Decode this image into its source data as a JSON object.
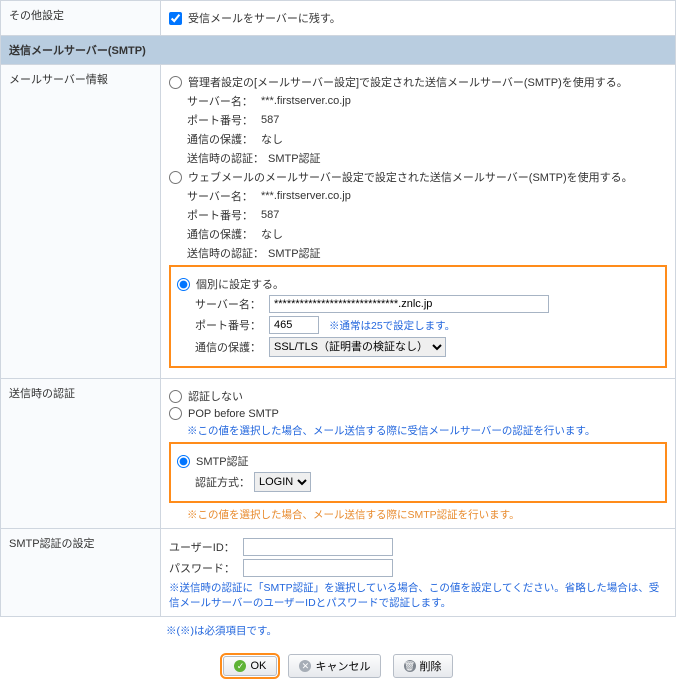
{
  "sections": {
    "other_label": "その他設定",
    "other_checkbox_label": "受信メールをサーバーに残す。",
    "smtp_header": "送信メールサーバー(SMTP)",
    "mailserver_label": "メールサーバー情報",
    "auth_label": "送信時の認証",
    "smtpauth_label": "SMTP認証の設定"
  },
  "mailserver": {
    "opt1": {
      "desc": "管理者設定の[メールサーバー設定]で設定された送信メールサーバー(SMTP)を使用する。",
      "server_label": "サーバー名：",
      "server_value": "***.firstserver.co.jp",
      "port_label": "ポート番号：",
      "port_value": "587",
      "ssl_label": "通信の保護：",
      "ssl_value": "なし",
      "authlabel": "送信時の認証：",
      "auth_value": "SMTP認証"
    },
    "opt2": {
      "desc": "ウェブメールのメールサーバー設定で設定された送信メールサーバー(SMTP)を使用する。",
      "server_label": "サーバー名：",
      "server_value": "***.firstserver.co.jp",
      "port_label": "ポート番号：",
      "port_value": "587",
      "ssl_label": "通信の保護：",
      "ssl_value": "なし",
      "authlabel": "送信時の認証：",
      "auth_value": "SMTP認証"
    },
    "opt3": {
      "desc": "個別に設定する。",
      "server_label": "サーバー名：",
      "server_value": "*****************************.znlc.jp",
      "port_label": "ポート番号：",
      "port_value": "465",
      "port_note": "※通常は25で設定します。",
      "ssl_label": "通信の保護：",
      "ssl_value": "SSL/TLS（証明書の検証なし）"
    }
  },
  "auth": {
    "none": "認証しない",
    "pop": "POP before SMTP",
    "pop_note": "※この値を選択した場合、メール送信する際に受信メールサーバーの認証を行います。",
    "smtp": "SMTP認証",
    "method_label": "認証方式：",
    "method_value": "LOGIN",
    "smtp_note": "※この値を選択した場合、メール送信する際にSMTP認証を行います。"
  },
  "smtpauth": {
    "user_label": "ユーザーID：",
    "pass_label": "パスワード：",
    "note": "※送信時の認証に「SMTP認証」を選択している場合、この値を設定してください。省略した場合は、受信メールサーバーのユーザーIDとパスワードで認証します。"
  },
  "footnote": "※(※)は必須項目です。",
  "buttons": {
    "ok": "OK",
    "cancel": "キャンセル",
    "delete": "削除"
  }
}
